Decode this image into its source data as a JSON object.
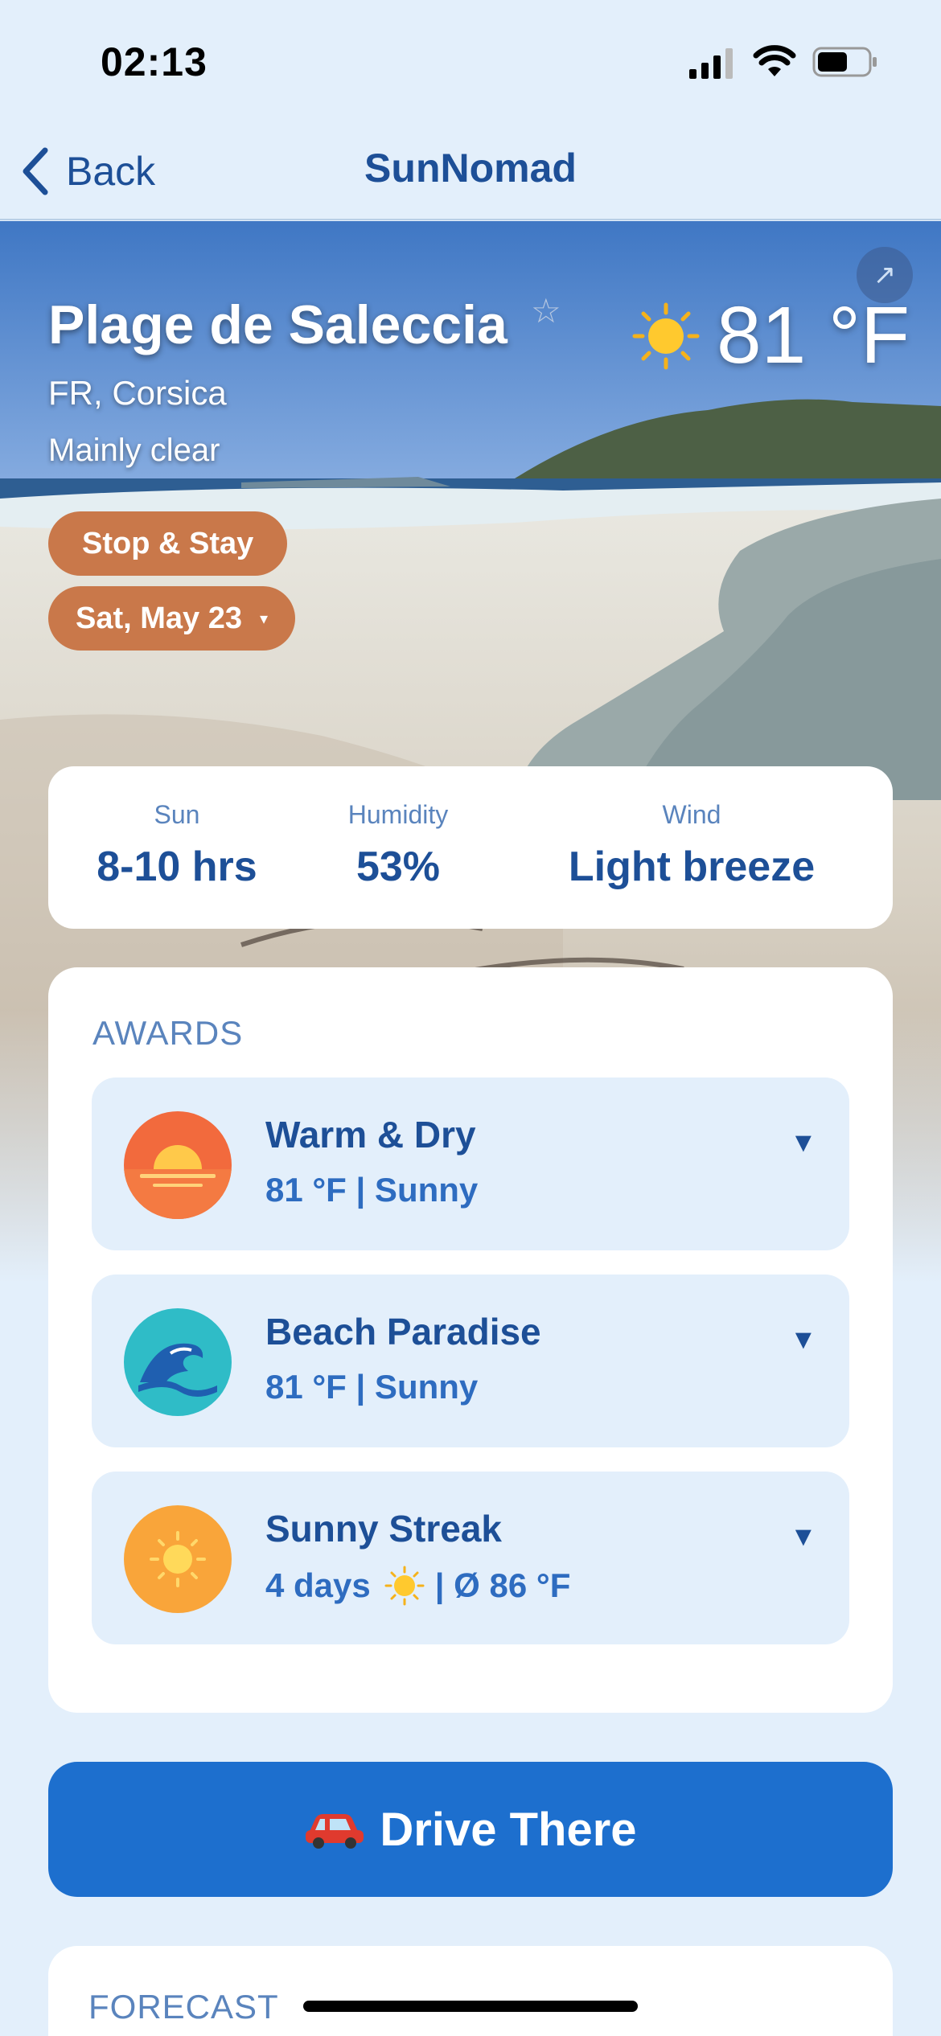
{
  "status_bar": {
    "time": "02:13",
    "icons": [
      "signal-icon",
      "wifi-icon",
      "battery-icon"
    ]
  },
  "nav": {
    "back_label": "Back",
    "title": "SunNomad"
  },
  "hero": {
    "place_name": "Plage de Saleccia",
    "region": "FR, Corsica",
    "condition": "Mainly clear",
    "temperature": "81 °F",
    "stop_label": "Stop & Stay",
    "date_label": "Sat, May 23",
    "date_caret": "▾",
    "favorite_glyph": "☆",
    "share_glyph": "↗"
  },
  "stats": {
    "sun": {
      "label": "Sun",
      "value": "8-10 hrs"
    },
    "humidity": {
      "label": "Humidity",
      "value": "53%"
    },
    "wind": {
      "label": "Wind",
      "value": "Light breeze"
    }
  },
  "awards": {
    "heading": "AWARDS",
    "caret": "▼",
    "items": [
      {
        "title": "Warm & Dry",
        "subtitle": "81 °F | Sunny",
        "icon": "sunset-icon"
      },
      {
        "title": "Beach Paradise",
        "subtitle": "81 °F | Sunny",
        "icon": "wave-icon"
      },
      {
        "title": "Sunny Streak",
        "subtitle_pre": "4 days",
        "subtitle_post": "| Ø 86 °F",
        "icon": "sun-icon"
      }
    ]
  },
  "drive_button": {
    "label": "Drive There",
    "icon": "car-icon"
  },
  "forecast": {
    "heading": "FORECAST"
  },
  "colors": {
    "accent": "#1d6fce",
    "text": "#1d4f97",
    "pill": "#c9784a",
    "background": "#e3effb"
  }
}
